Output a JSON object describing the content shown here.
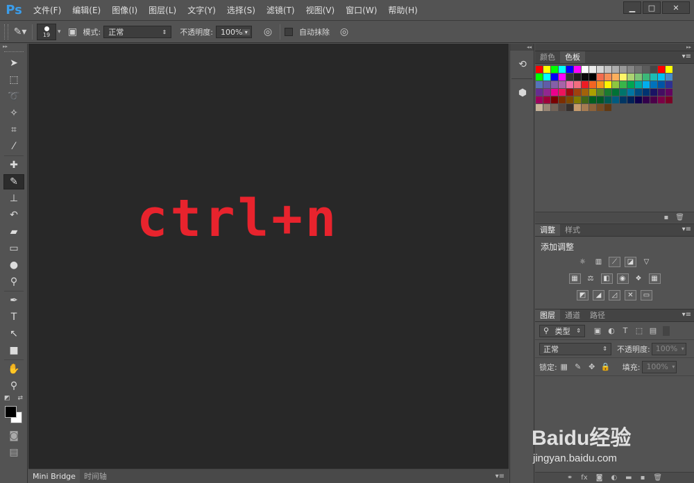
{
  "app": {
    "logo": "Ps"
  },
  "menu": [
    "文件(F)",
    "编辑(E)",
    "图像(I)",
    "图层(L)",
    "文字(Y)",
    "选择(S)",
    "滤镜(T)",
    "视图(V)",
    "窗口(W)",
    "帮助(H)"
  ],
  "window_controls": {
    "minimize": "▁",
    "maximize": "□",
    "close": "✕"
  },
  "options": {
    "brush_size": "19",
    "mode_label": "模式:",
    "mode_value": "正常",
    "opacity_label": "不透明度:",
    "opacity_value": "100%",
    "auto_erase_label": "自动抹除"
  },
  "canvas": {
    "text": "ctrl+n",
    "text_color": "#e8232d"
  },
  "bottom_tabs": [
    "Mini Bridge",
    "时间轴"
  ],
  "swatches_panel": {
    "tabs": [
      "颜色",
      "色板"
    ],
    "active": "色板"
  },
  "swatch_colors": [
    "#ff0000",
    "#ffff00",
    "#00ff00",
    "#00ffff",
    "#0000ff",
    "#ff00ff",
    "#ffffff",
    "#ebebeb",
    "#d6d6d6",
    "#c2c2c2",
    "#adadad",
    "#999999",
    "#858585",
    "#707070",
    "#5c5c5c",
    "#474747",
    "#ff0000",
    "#ffff00",
    "#00ff00",
    "#00ffff",
    "#0000ff",
    "#ff00ff",
    "#333333",
    "#1f1f1f",
    "#0a0a0a",
    "#000000",
    "#f26c4f",
    "#f68e56",
    "#fbaf5d",
    "#fff568",
    "#acd372",
    "#7cc576",
    "#3bb878",
    "#1abbb4",
    "#00bff3",
    "#438ccb",
    "#5574b9",
    "#605ca8",
    "#855fa8",
    "#a763a8",
    "#f06ea9",
    "#f26d7d",
    "#ed1c24",
    "#f26522",
    "#f7941d",
    "#fff200",
    "#8dc73f",
    "#39b54a",
    "#00a651",
    "#00a99d",
    "#00aeef",
    "#0072bc",
    "#0054a6",
    "#2e3192",
    "#662d91",
    "#92278f",
    "#ec008c",
    "#ed145b",
    "#9e0b0f",
    "#a0410d",
    "#a3620a",
    "#aba000",
    "#598527",
    "#1a7b30",
    "#007236",
    "#00746b",
    "#0076a3",
    "#004b80",
    "#003471",
    "#1b1464",
    "#440e62",
    "#630460",
    "#9e005d",
    "#9e0039",
    "#790000",
    "#7b2e00",
    "#7d4900",
    "#827b00",
    "#406618",
    "#005e20",
    "#005826",
    "#005952",
    "#005b7f",
    "#003663",
    "#002157",
    "#0d004c",
    "#32004b",
    "#4b0049",
    "#7b0046",
    "#7a0026",
    "#c7b299",
    "#998675",
    "#736357",
    "#534741",
    "#37302d",
    "#c69c6d",
    "#a67c52",
    "#8c6239",
    "#754c24",
    "#603913"
  ],
  "adjustments_panel": {
    "tabs": [
      "调整",
      "样式"
    ],
    "active": "调整",
    "title": "添加调整"
  },
  "layers_panel": {
    "tabs": [
      "图层",
      "通道",
      "路径"
    ],
    "active": "图层",
    "filter_label": "类型",
    "blend_mode": "正常",
    "opacity_label": "不透明度:",
    "opacity_value": "100%",
    "lock_label": "锁定:",
    "fill_label": "填充:",
    "fill_value": "100%"
  },
  "watermark": {
    "brand": "Baidu经验",
    "url": "jingyan.baidu.com"
  }
}
